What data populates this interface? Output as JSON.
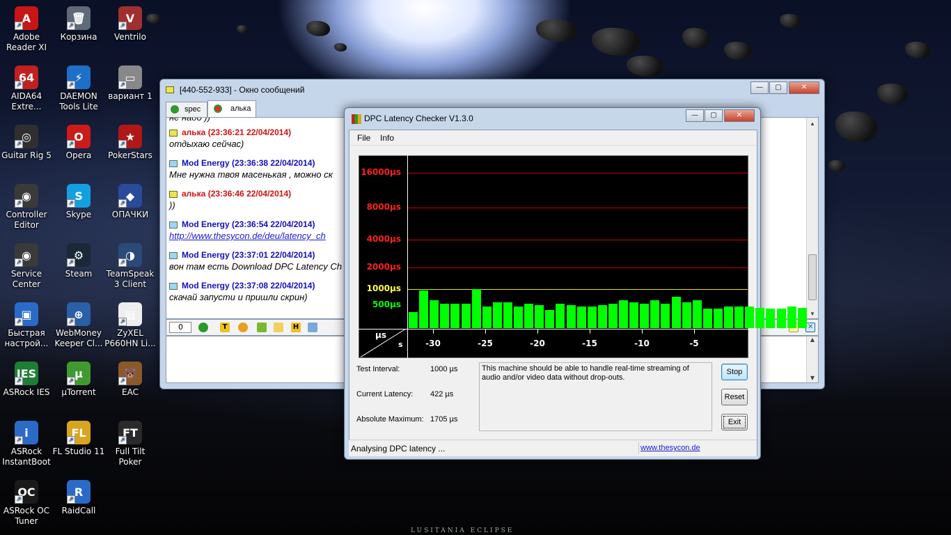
{
  "desktop": {
    "icons": [
      {
        "label": "Adobe Reader XI",
        "color": "#c81515",
        "glyph": "A"
      },
      {
        "label": "Корзина",
        "color": "#5f6a78",
        "glyph": "🗑"
      },
      {
        "label": "Ventrilo",
        "color": "#a03030",
        "glyph": "V"
      },
      {
        "label": "AIDA64 Extre...",
        "color": "#c02020",
        "glyph": "64"
      },
      {
        "label": "DAEMON Tools Lite",
        "color": "#1d6fc7",
        "glyph": "⚡"
      },
      {
        "label": "вариант 1",
        "color": "#888888",
        "glyph": "▭"
      },
      {
        "label": "Guitar Rig 5",
        "color": "#2f2f2f",
        "glyph": "◎"
      },
      {
        "label": "Opera",
        "color": "#cc1b1b",
        "glyph": "O"
      },
      {
        "label": "PokerStars",
        "color": "#b01818",
        "glyph": "★"
      },
      {
        "label": "Controller Editor",
        "color": "#3a3a3a",
        "glyph": "◉"
      },
      {
        "label": "Skype",
        "color": "#14a0e0",
        "glyph": "S"
      },
      {
        "label": "ОПАЧКИ",
        "color": "#2a4a9a",
        "glyph": "◆"
      },
      {
        "label": "Service Center",
        "color": "#3a3a3a",
        "glyph": "◉"
      },
      {
        "label": "Steam",
        "color": "#1b2838",
        "glyph": "⚙"
      },
      {
        "label": "TeamSpeak 3 Client",
        "color": "#2a4a7a",
        "glyph": "◑"
      },
      {
        "label": "Быстрая настрой...",
        "color": "#2a6bc8",
        "glyph": "▣"
      },
      {
        "label": "WebMoney Keeper Cl...",
        "color": "#2a5fa8",
        "glyph": "⊕"
      },
      {
        "label": "ZyXEL P660HN Li...",
        "color": "#eeeeee",
        "glyph": "▤"
      },
      {
        "label": "ASRock IES",
        "color": "#1e7e34",
        "glyph": "IES"
      },
      {
        "label": "µTorrent",
        "color": "#3f9b2f",
        "glyph": "µ"
      },
      {
        "label": "EAC",
        "color": "#8a5a2a",
        "glyph": "🐻"
      },
      {
        "label": "ASRock InstantBoot",
        "color": "#2a6bc8",
        "glyph": "i"
      },
      {
        "label": "FL Studio 11",
        "color": "#d9a520",
        "glyph": "FL"
      },
      {
        "label": "Full Tilt Poker",
        "color": "#2a2a2a",
        "glyph": "FT"
      },
      {
        "label": "ASRock OC Tuner",
        "color": "#1a1a1a",
        "glyph": "OC"
      },
      {
        "label": "RaidCall",
        "color": "#2a6bc8",
        "glyph": "R"
      }
    ],
    "wallpaper_caption": "LUSITANIA ECLIPSE"
  },
  "chat_window": {
    "title": "[440-552-933] - Окно сообщений",
    "tabs": [
      {
        "label": "spec"
      },
      {
        "label": "алька"
      }
    ],
    "partial_top_line": "не надо ))",
    "messages": [
      {
        "sender": "алька",
        "time": "(23:36:21 22/04/2014)",
        "text": "отдыхаю сейчас)",
        "color": "#d01010"
      },
      {
        "sender": "Mod Energy",
        "time": "(23:36:38 22/04/2014)",
        "text": "Мне нужна твоя масенькая , можно ск",
        "color": "#1010c0"
      },
      {
        "sender": "алька",
        "time": "(23:36:46 22/04/2014)",
        "text": "))",
        "color": "#d01010"
      },
      {
        "sender": "Mod Energy",
        "time": "(23:36:54 22/04/2014)",
        "text": "http://www.thesycon.de/deu/latency_ch",
        "color": "#1010c0",
        "link": true
      },
      {
        "sender": "Mod Energy",
        "time": "(23:37:01 22/04/2014)",
        "text": "вон там есть  Download DPC Latency Ch",
        "color": "#1010c0"
      },
      {
        "sender": "Mod Energy",
        "time": "(23:37:08 22/04/2014)",
        "text": "скачай запусти и пришли скрин)",
        "color": "#1010c0"
      }
    ],
    "toolbar_counter": "0"
  },
  "dpc_window": {
    "title": "DPC Latency Checker V1.3.0",
    "menu": [
      "File",
      "Info"
    ],
    "test_interval_label": "Test Interval:",
    "test_interval_value": "1000 µs",
    "current_latency_label": "Current Latency:",
    "current_latency_value": "422 µs",
    "absolute_max_label": "Absolute Maximum:",
    "absolute_max_value": "1705 µs",
    "message": "This machine should be able to handle real-time streaming of audio and/or video data without drop-outs.",
    "buttons": {
      "stop": "Stop",
      "reset": "Reset",
      "exit": "Exit"
    },
    "status": "Analysing DPC latency ...",
    "link": "www.thesycon.de",
    "colors": {
      "bar": "#00ff00",
      "grid_red": "#d00000",
      "grid_yellow": "#e8e800",
      "label_red": "#ff2020",
      "label_yellow": "#ffff40",
      "label_green": "#00ff00"
    }
  },
  "chart_data": {
    "type": "bar",
    "title": "",
    "ylabel": "µs",
    "xlabel": "s",
    "y_scale": "log",
    "y_ticks": [
      {
        "value": 16000,
        "label": "16000µs",
        "color": "red"
      },
      {
        "value": 8000,
        "label": "8000µs",
        "color": "red"
      },
      {
        "value": 4000,
        "label": "4000µs",
        "color": "red"
      },
      {
        "value": 2000,
        "label": "2000µs",
        "color": "red"
      },
      {
        "value": 1000,
        "label": "1000µs",
        "color": "yellow"
      },
      {
        "value": 500,
        "label": "500µs",
        "color": "green"
      }
    ],
    "x_ticks": [
      "-30",
      "-25",
      "-20",
      "-15",
      "-10",
      "-5"
    ],
    "values": [
      420,
      720,
      560,
      520,
      520,
      520,
      750,
      480,
      540,
      540,
      480,
      520,
      500,
      440,
      520,
      500,
      480,
      480,
      500,
      520,
      560,
      540,
      520,
      560,
      520,
      620,
      540,
      560,
      460,
      460,
      480,
      480,
      480,
      470,
      460,
      460,
      480,
      470
    ]
  }
}
